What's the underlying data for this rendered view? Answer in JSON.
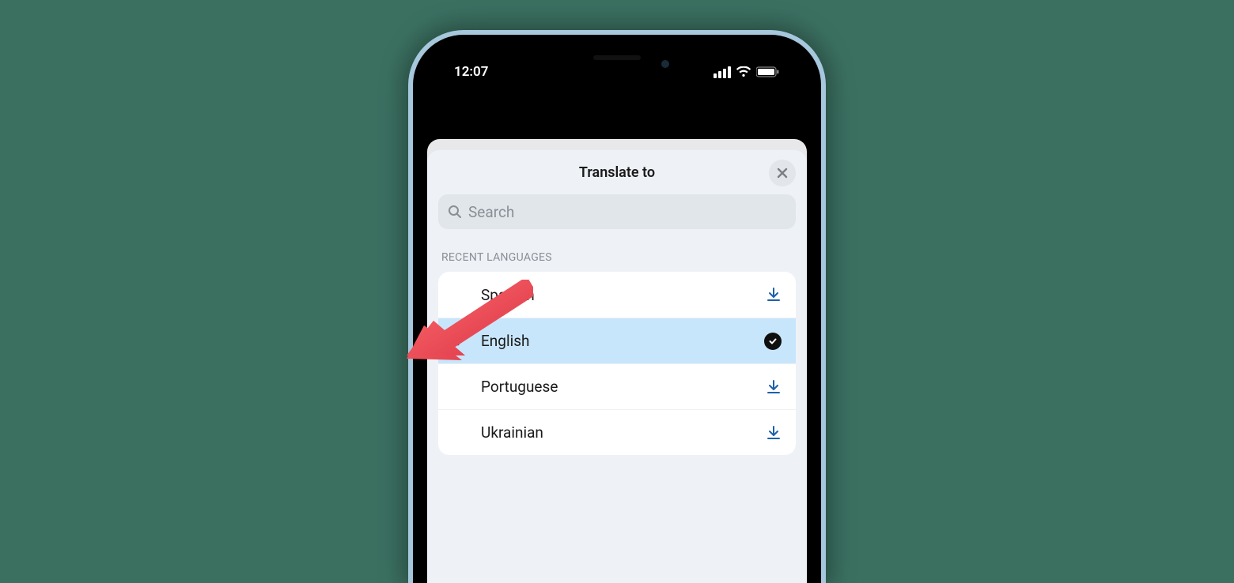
{
  "status": {
    "time": "12:07"
  },
  "sheet": {
    "title": "Translate to",
    "search_placeholder": "Search",
    "section_label": "RECENT LANGUAGES",
    "rows": [
      {
        "label": "Spanish",
        "selected": false,
        "downloaded": false
      },
      {
        "label": "English",
        "selected": true,
        "downloaded": true
      },
      {
        "label": "Portuguese",
        "selected": false,
        "downloaded": false
      },
      {
        "label": "Ukrainian",
        "selected": false,
        "downloaded": false
      }
    ]
  }
}
